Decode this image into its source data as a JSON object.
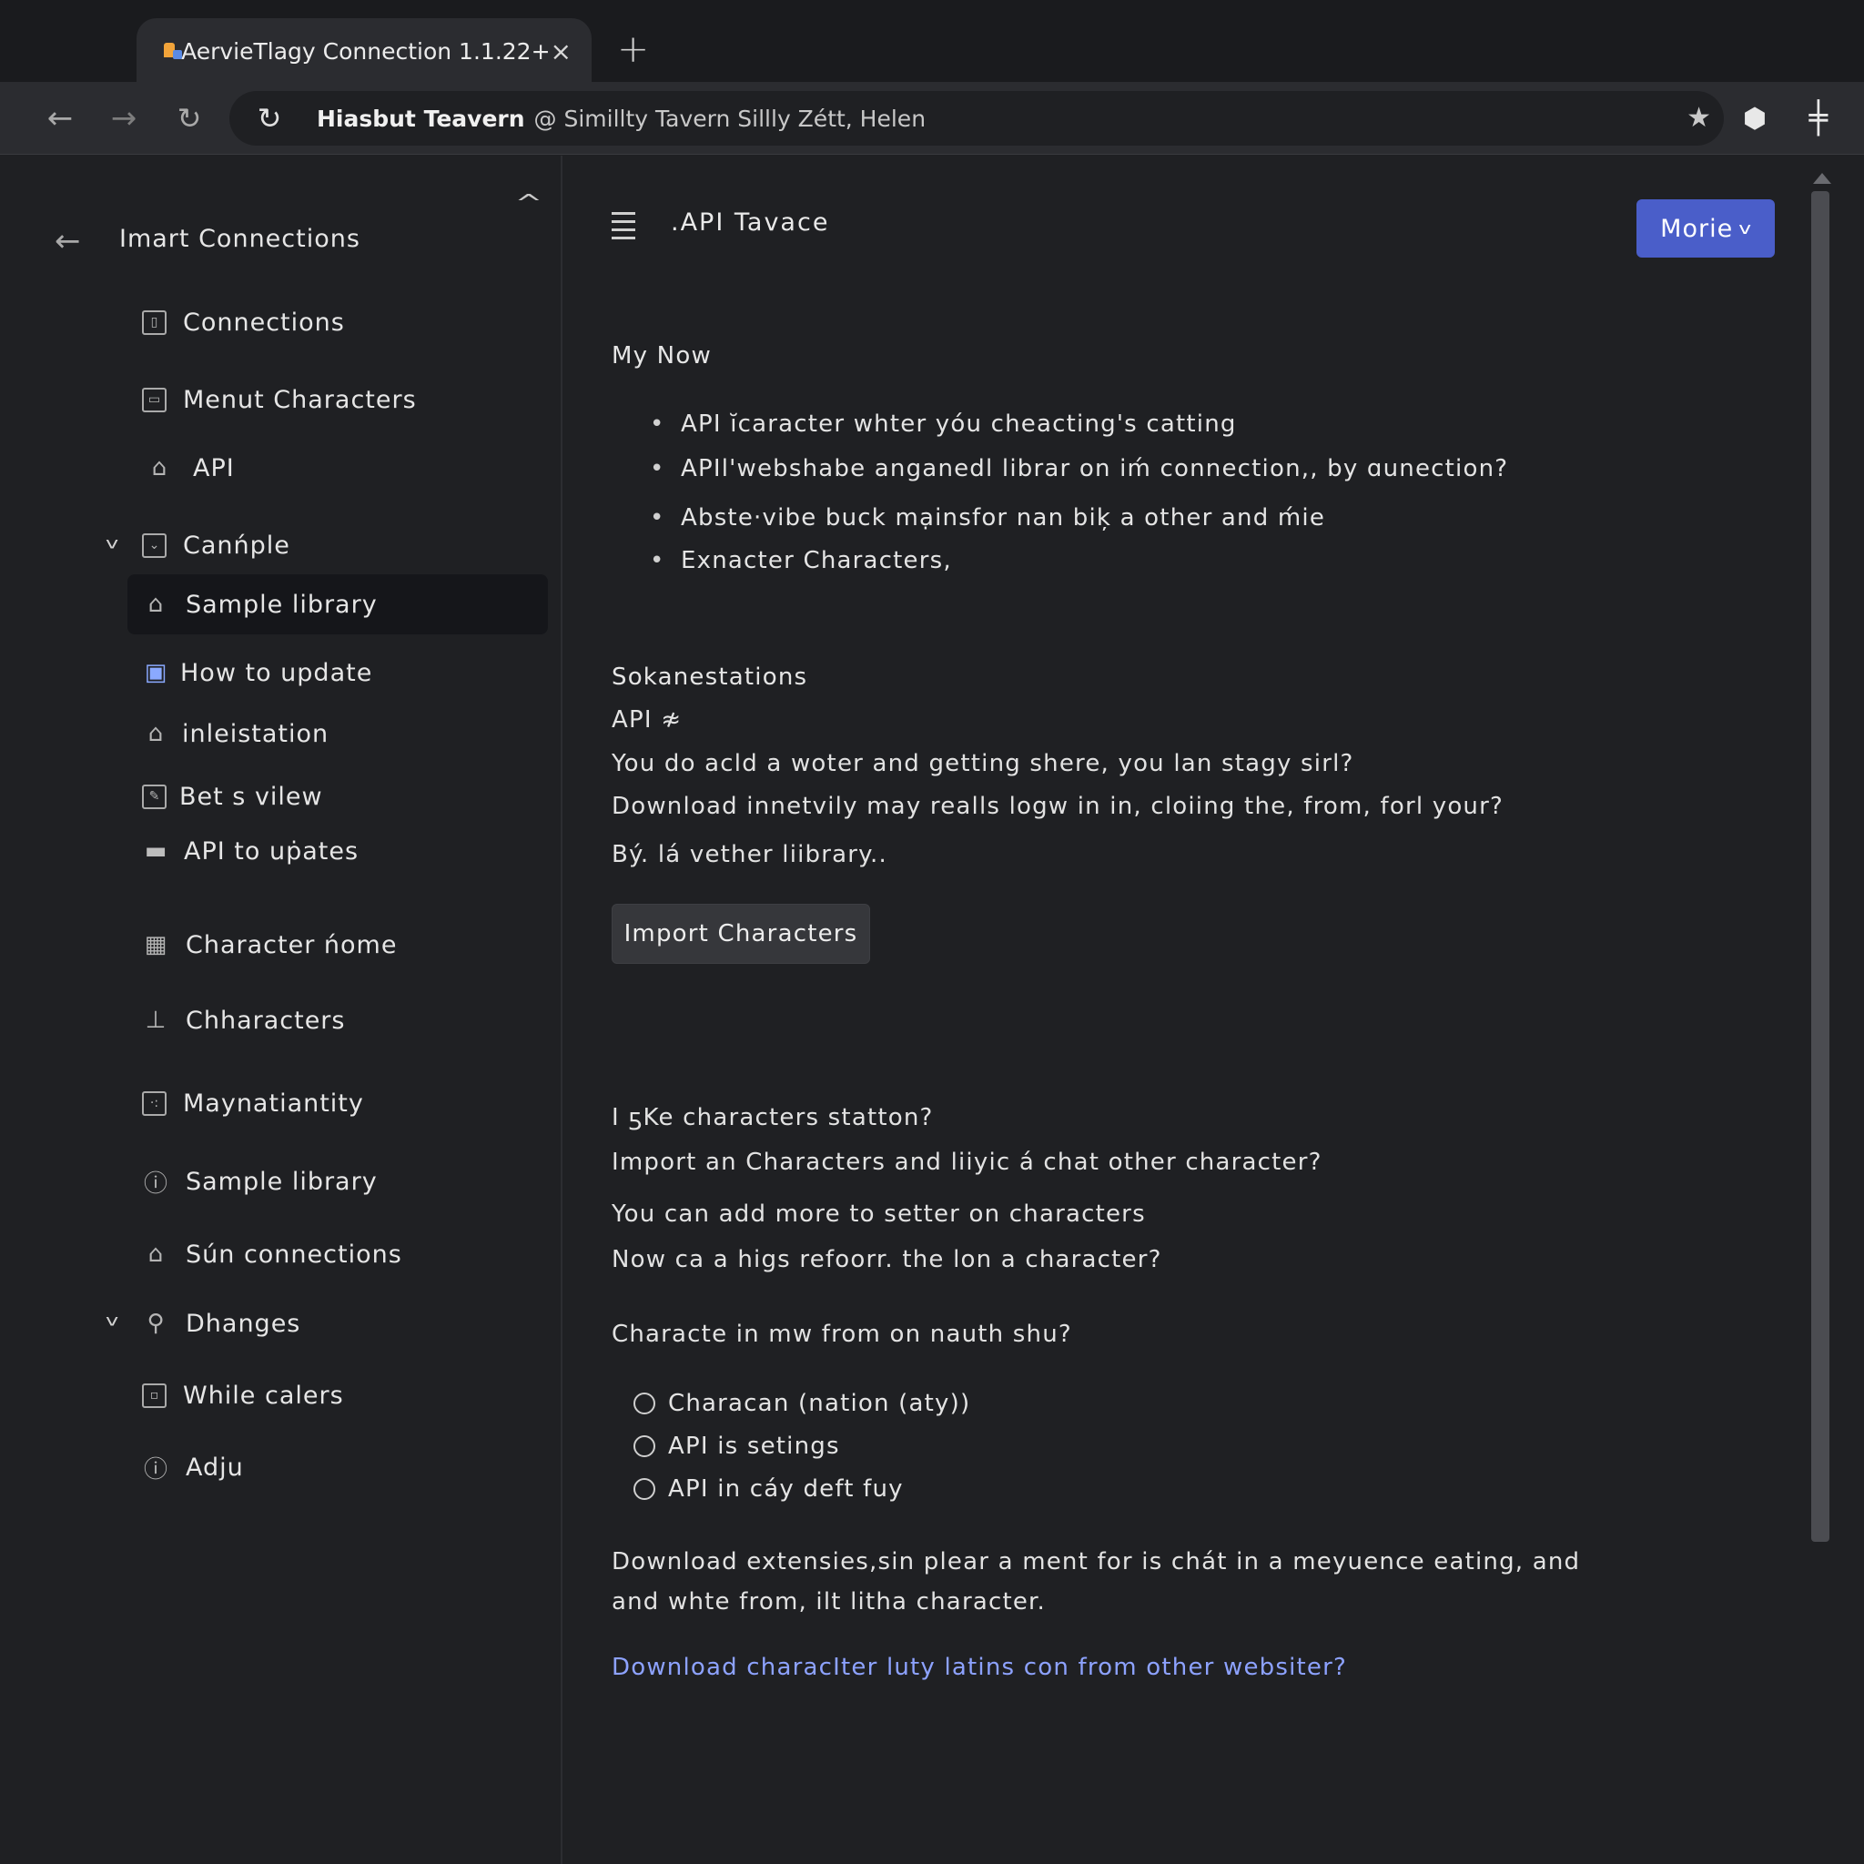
{
  "browser": {
    "tab_title": "AervieTlagy Connection   1.1.22+",
    "tab_close": "×",
    "new_tab": "+",
    "url_host": "Hiasbut Teavern",
    "url_rest": "@ Simillty Tavern Sillly Zétt, Helen"
  },
  "sidebar": {
    "title": "Imart Connections",
    "items": [
      {
        "label": "Connections",
        "icon": "book-icon"
      },
      {
        "label": "Menut Characters",
        "icon": "card-icon"
      },
      {
        "label": "API",
        "icon": "home-icon"
      },
      {
        "label": "Canńple",
        "icon": "box-icon"
      },
      {
        "label": "Sample library",
        "icon": "home-icon"
      },
      {
        "label": "How to update",
        "icon": "printer-icon"
      },
      {
        "label": "inleistation",
        "icon": "house-outline-icon"
      },
      {
        "label": "Bet s vilew",
        "icon": "edit-icon"
      },
      {
        "label": "API to uṗates",
        "icon": "folder-icon"
      },
      {
        "label": "Character ńome",
        "icon": "building-icon"
      },
      {
        "label": "Chharacters",
        "icon": "pin-icon"
      },
      {
        "label": "Maynatiantity",
        "icon": "box-icon"
      },
      {
        "label": "Sample library",
        "icon": "info-circle-icon"
      },
      {
        "label": "Sún connections",
        "icon": "house-outline-icon"
      },
      {
        "label": "Dhanges",
        "icon": "person-icon"
      },
      {
        "label": "While calers",
        "icon": "window-icon"
      },
      {
        "label": "Adju",
        "icon": "info-circle-icon"
      }
    ]
  },
  "main": {
    "title": ".API Tavace",
    "more_button": "Morie",
    "section1_heading": "My Now",
    "bullets": [
      "API ĭcaracter whter yóu cheacting's catting",
      "APIl'webshabe anganedl librar on iḿ connection,, by ɑunection?",
      "Abste·vibe buck mạinsfor nan biķ a other and ḿie",
      "Exnacter Characters,"
    ],
    "section2_heading": "Sokanestations",
    "api_line": "API ≉",
    "para_lines": [
      "You do acld a woter and getting shere, you lan stagy sirl?",
      "Download innetvily may realls logw in in, cloiing the, from, forl your?",
      "Bý. lá vether liibrary.."
    ],
    "import_button": "Import Characters",
    "questions": [
      "I ƽKe characters statton?",
      "Import an Characters and liiyic á chat other character?",
      "You can add more to setter on characters",
      "Now ca a higs refoorr. the lon a character?"
    ],
    "radio_question": "Characte in mw from on nauth shu?",
    "radios": [
      "Characan (nation (aty))",
      "API is setings",
      "API in cáy deft fuy"
    ],
    "download_lines": [
      "Download extensies,sin plear a ment for is chát in a meyuence eating, and",
      "and whte from, ilt litha character."
    ],
    "link": "Download characIter luty latins con from other websiter?"
  }
}
